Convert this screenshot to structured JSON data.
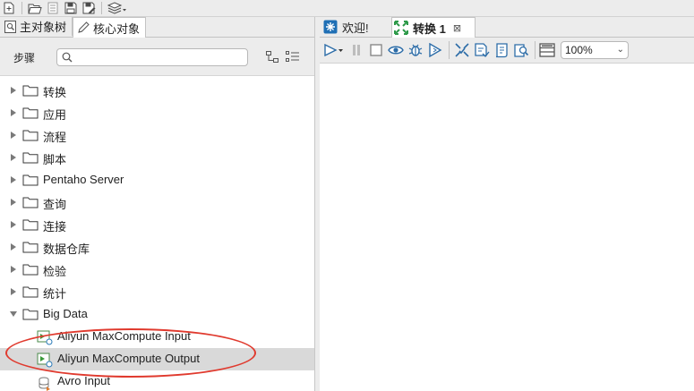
{
  "top_toolbar": {
    "icons": [
      "new-file-icon",
      "open-folder-icon",
      "explore-repository-icon",
      "save-icon",
      "save-as-icon",
      "layers-icon"
    ]
  },
  "left_panel": {
    "tabs": [
      {
        "label": "主对象树",
        "icon": "tree-icon",
        "active": false
      },
      {
        "label": "核心对象",
        "icon": "pencil-icon",
        "active": true
      }
    ],
    "steps_label": "步骤",
    "search": {
      "placeholder": "",
      "value": ""
    },
    "tree": [
      {
        "label": "转换",
        "type": "folder",
        "expanded": false
      },
      {
        "label": "应用",
        "type": "folder",
        "expanded": false
      },
      {
        "label": "流程",
        "type": "folder",
        "expanded": false
      },
      {
        "label": "脚本",
        "type": "folder",
        "expanded": false
      },
      {
        "label": "Pentaho Server",
        "type": "folder",
        "expanded": false
      },
      {
        "label": "查询",
        "type": "folder",
        "expanded": false
      },
      {
        "label": "连接",
        "type": "folder",
        "expanded": false
      },
      {
        "label": "数据仓库",
        "type": "folder",
        "expanded": false
      },
      {
        "label": "检验",
        "type": "folder",
        "expanded": false
      },
      {
        "label": "统计",
        "type": "folder",
        "expanded": false
      },
      {
        "label": "Big Data",
        "type": "folder",
        "expanded": true
      },
      {
        "label": "Aliyun MaxCompute Input",
        "type": "step",
        "selected": false
      },
      {
        "label": "Aliyun MaxCompute Output",
        "type": "step",
        "selected": true
      },
      {
        "label": "Avro Input",
        "type": "step",
        "selected": false
      }
    ],
    "annotation_color": "#e03a2e"
  },
  "right_panel": {
    "tabs": [
      {
        "label": "欢迎!",
        "icon": "welcome-icon",
        "active": false
      },
      {
        "label": "转换 1",
        "icon": "transformation-icon",
        "active": true,
        "closable": true
      }
    ],
    "toolbar": {
      "icons": [
        "run-icon",
        "pause-icon",
        "stop-icon",
        "preview-icon",
        "debug-icon",
        "replay-icon",
        "verify-icon",
        "analyze-impact-icon",
        "sql-icon",
        "explore-db-icon",
        "show-results-icon"
      ],
      "zoom": "100%"
    }
  }
}
